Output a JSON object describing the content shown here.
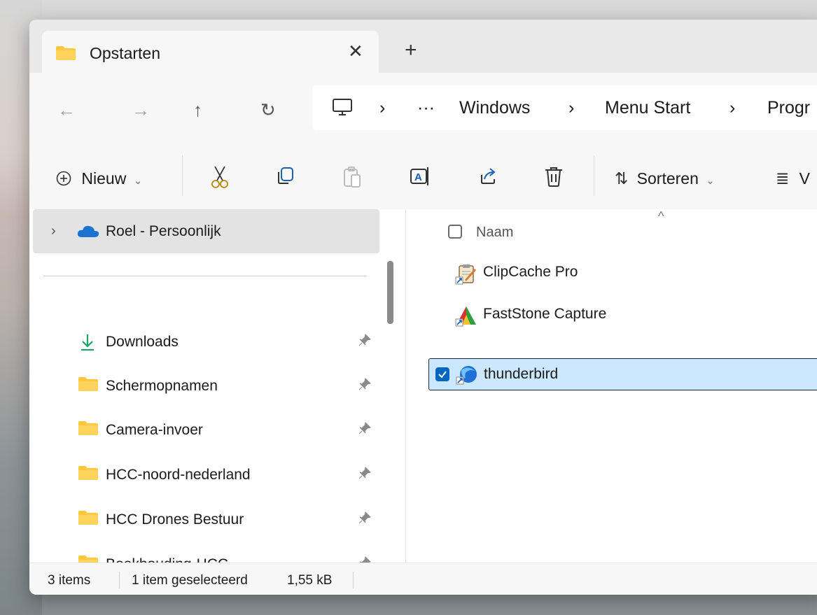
{
  "tab": {
    "title": "Opstarten",
    "close_label": "✕",
    "new_tab_label": "+"
  },
  "navigation": {
    "back": "←",
    "forward": "→",
    "up": "↑",
    "refresh": "↻"
  },
  "breadcrumb": {
    "separator": "›",
    "overflow": "···",
    "items": [
      "Windows",
      "Menu Start",
      "Progr"
    ]
  },
  "toolbar": {
    "new_label": "Nieuw",
    "sort_label": "Sorteren",
    "view_label_partial": "V",
    "dropdown_caret": "⌄"
  },
  "sidebar": {
    "onedrive_label": "Roel - Persoonlijk",
    "quick_access": [
      {
        "label": "Downloads",
        "icon": "download-icon"
      },
      {
        "label": "Schermopnamen",
        "icon": "folder-icon"
      },
      {
        "label": "Camera-invoer",
        "icon": "folder-icon"
      },
      {
        "label": "HCC-noord-nederland",
        "icon": "folder-icon"
      },
      {
        "label": "HCC Drones Bestuur",
        "icon": "folder-icon"
      },
      {
        "label": "Boekhouding-HCC",
        "icon": "folder-icon"
      }
    ]
  },
  "content": {
    "column_name": "Naam",
    "files": [
      {
        "name": "ClipCache Pro",
        "selected": false
      },
      {
        "name": "FastStone Capture",
        "selected": false
      },
      {
        "name": "thunderbird",
        "selected": true
      }
    ]
  },
  "status": {
    "item_count": "3 items",
    "selection": "1 item geselecteerd",
    "size": "1,55 kB"
  },
  "colors": {
    "folder_yellow": "#ffc83d",
    "selection_bg": "#cce8ff",
    "accent_blue": "#0067c0",
    "download_green": "#1aa36b"
  }
}
